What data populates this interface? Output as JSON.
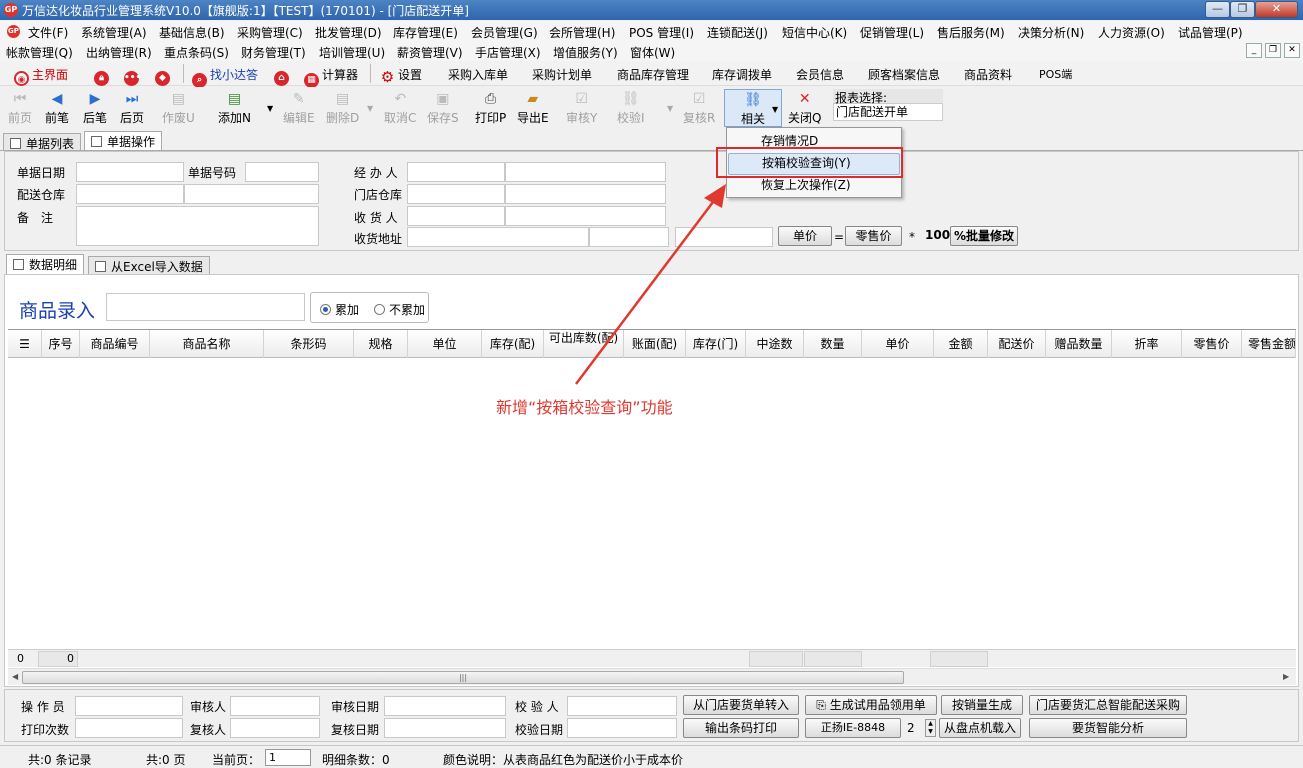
{
  "window": {
    "title": "万信达化妆品行业管理系统V10.0【旗舰版:1】【TEST】(170101) - [门店配送开单]",
    "logo_text": "GP",
    "minimize": "—",
    "restore": "❐",
    "close": "✕"
  },
  "menu1": [
    {
      "id": "file",
      "label": "文件(F)"
    },
    {
      "id": "system",
      "label": "系统管理(A)"
    },
    {
      "id": "basic",
      "label": "基础信息(B)"
    },
    {
      "id": "purchase",
      "label": "采购管理(C)"
    },
    {
      "id": "wholesale",
      "label": "批发管理(D)"
    },
    {
      "id": "stock",
      "label": "库存管理(E)"
    },
    {
      "id": "member",
      "label": "会员管理(G)"
    },
    {
      "id": "club",
      "label": "会所管理(H)"
    },
    {
      "id": "pos",
      "label": "POS 管理(I)"
    },
    {
      "id": "chain",
      "label": "连锁配送(J)"
    },
    {
      "id": "sms",
      "label": "短信中心(K)"
    },
    {
      "id": "promo",
      "label": "促销管理(L)"
    },
    {
      "id": "aftersale",
      "label": "售后服务(M)"
    },
    {
      "id": "decision",
      "label": "决策分析(N)"
    },
    {
      "id": "hr",
      "label": "人力资源(O)"
    },
    {
      "id": "trial",
      "label": "试品管理(P)"
    }
  ],
  "menu2": [
    {
      "id": "account",
      "label": "帐款管理(Q)"
    },
    {
      "id": "order",
      "label": "出纳管理(R)"
    },
    {
      "id": "barcode",
      "label": "重点条码(S)"
    },
    {
      "id": "finance",
      "label": "财务管理(T)"
    },
    {
      "id": "training",
      "label": "培训管理(U)"
    },
    {
      "id": "salary",
      "label": "薪资管理(V)"
    },
    {
      "id": "shop",
      "label": "手店管理(X)"
    },
    {
      "id": "value",
      "label": "增值服务(Y)"
    },
    {
      "id": "windows",
      "label": "窗体(W)"
    }
  ],
  "quick": {
    "home": "主界面",
    "find": "找小达答",
    "calc": "计算器",
    "settings": "设置",
    "links": [
      "采购入库单",
      "采购计划单",
      "商品库存管理",
      "库存调拨单",
      "会员信息",
      "顾客档案信息",
      "商品资料",
      "POS端"
    ]
  },
  "toolbar": {
    "first": "前页",
    "prev": "前笔",
    "next": "后笔",
    "last": "后页",
    "void": "作废U",
    "add": "添加N",
    "edit": "编辑E",
    "delete": "删除D",
    "cancel": "取消C",
    "save": "保存S",
    "print": "打印P",
    "export": "导出E",
    "audit": "审核Y",
    "verify": "校验I",
    "reaudit": "复核R",
    "related": "相关",
    "close": "关闭Q",
    "report_label": "报表选择:",
    "report_value": "门店配送开单"
  },
  "tabs": {
    "list": "单据列表",
    "operate": "单据操作"
  },
  "form": {
    "date": "单据日期",
    "number": "单据号码",
    "handler": "经 办 人",
    "warehouse": "配送仓库",
    "store_wh": "门店仓库",
    "remark": "备　注",
    "receiver": "收 货 人",
    "address": "收货地址",
    "unit_price_btn": "单价",
    "equals": "=",
    "retail_price_btn": "零售价",
    "times": "*",
    "percent": "100",
    "batch_btn": "%批量修改"
  },
  "dropdown": {
    "items": [
      "存销情况D",
      "按箱校验查询(Y)",
      "恢复上次操作(Z)"
    ]
  },
  "data_tabs": {
    "detail": "数据明细",
    "excel": "从Excel导入数据"
  },
  "entry": {
    "label": "商品录入",
    "accumulate": "累加",
    "no_accumulate": "不累加"
  },
  "grid": {
    "columns": [
      "序号",
      "商品编号",
      "商品名称",
      "条形码",
      "规格",
      "单位",
      "库存(配)",
      "可出库数(配)",
      "账面(配)",
      "库存(门)",
      "中途数",
      "数量",
      "单价",
      "金额",
      "配送价",
      "赠品数量",
      "折率",
      "零售价",
      "零售金额"
    ],
    "footer_count": "0",
    "footer_value": "0"
  },
  "annotation": "新增“按箱校验查询”功能",
  "bottom": {
    "operator": "操 作 员",
    "auditor": "审核人",
    "audit_date": "审核日期",
    "verifier": "校 验 人",
    "print_count": "打印次数",
    "reviewer": "复核人",
    "review_date": "复核日期",
    "verify_date": "校验日期",
    "btn_import": "从门店要货单转入",
    "btn_trial": "生成试用品领用单",
    "btn_sales": "按销量生成",
    "btn_smart": "门店要货汇总智能配送采购",
    "btn_barcode": "输出条码打印",
    "btn_device": "正扬IE-8848",
    "stepper_value": "2",
    "btn_load": "从盘点机载入",
    "btn_analysis": "要货智能分析"
  },
  "status": {
    "records": "共:0 条记录",
    "pages": "共:0 页",
    "current_page_label": "当前页：",
    "current_page": "1",
    "details": "明细条数：0",
    "color_note": "颜色说明：从表商品红色为配送价小于成本价"
  },
  "colors": {
    "title_bar": "#3a6fb5",
    "accent_red": "#e0392f",
    "entry_blue": "#1a3fb3"
  }
}
